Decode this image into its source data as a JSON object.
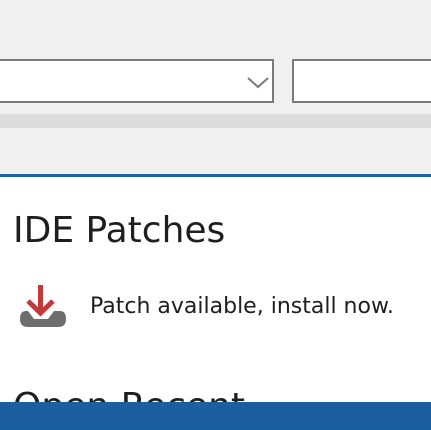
{
  "toolbar": {
    "combo_value": "",
    "search_value": ""
  },
  "panel": {
    "title": "IDE Patches",
    "patch_message": "Patch available, install now.",
    "next_heading": "Open Recent"
  },
  "colors": {
    "accent_blue": "#1d5fa0",
    "status_bar": "#1c5fa1",
    "download_arrow": "#c0393b",
    "tray_gray": "#6d6d6d"
  },
  "icons": {
    "combo_arrow": "chevron-down-icon",
    "patch": "download-icon"
  }
}
